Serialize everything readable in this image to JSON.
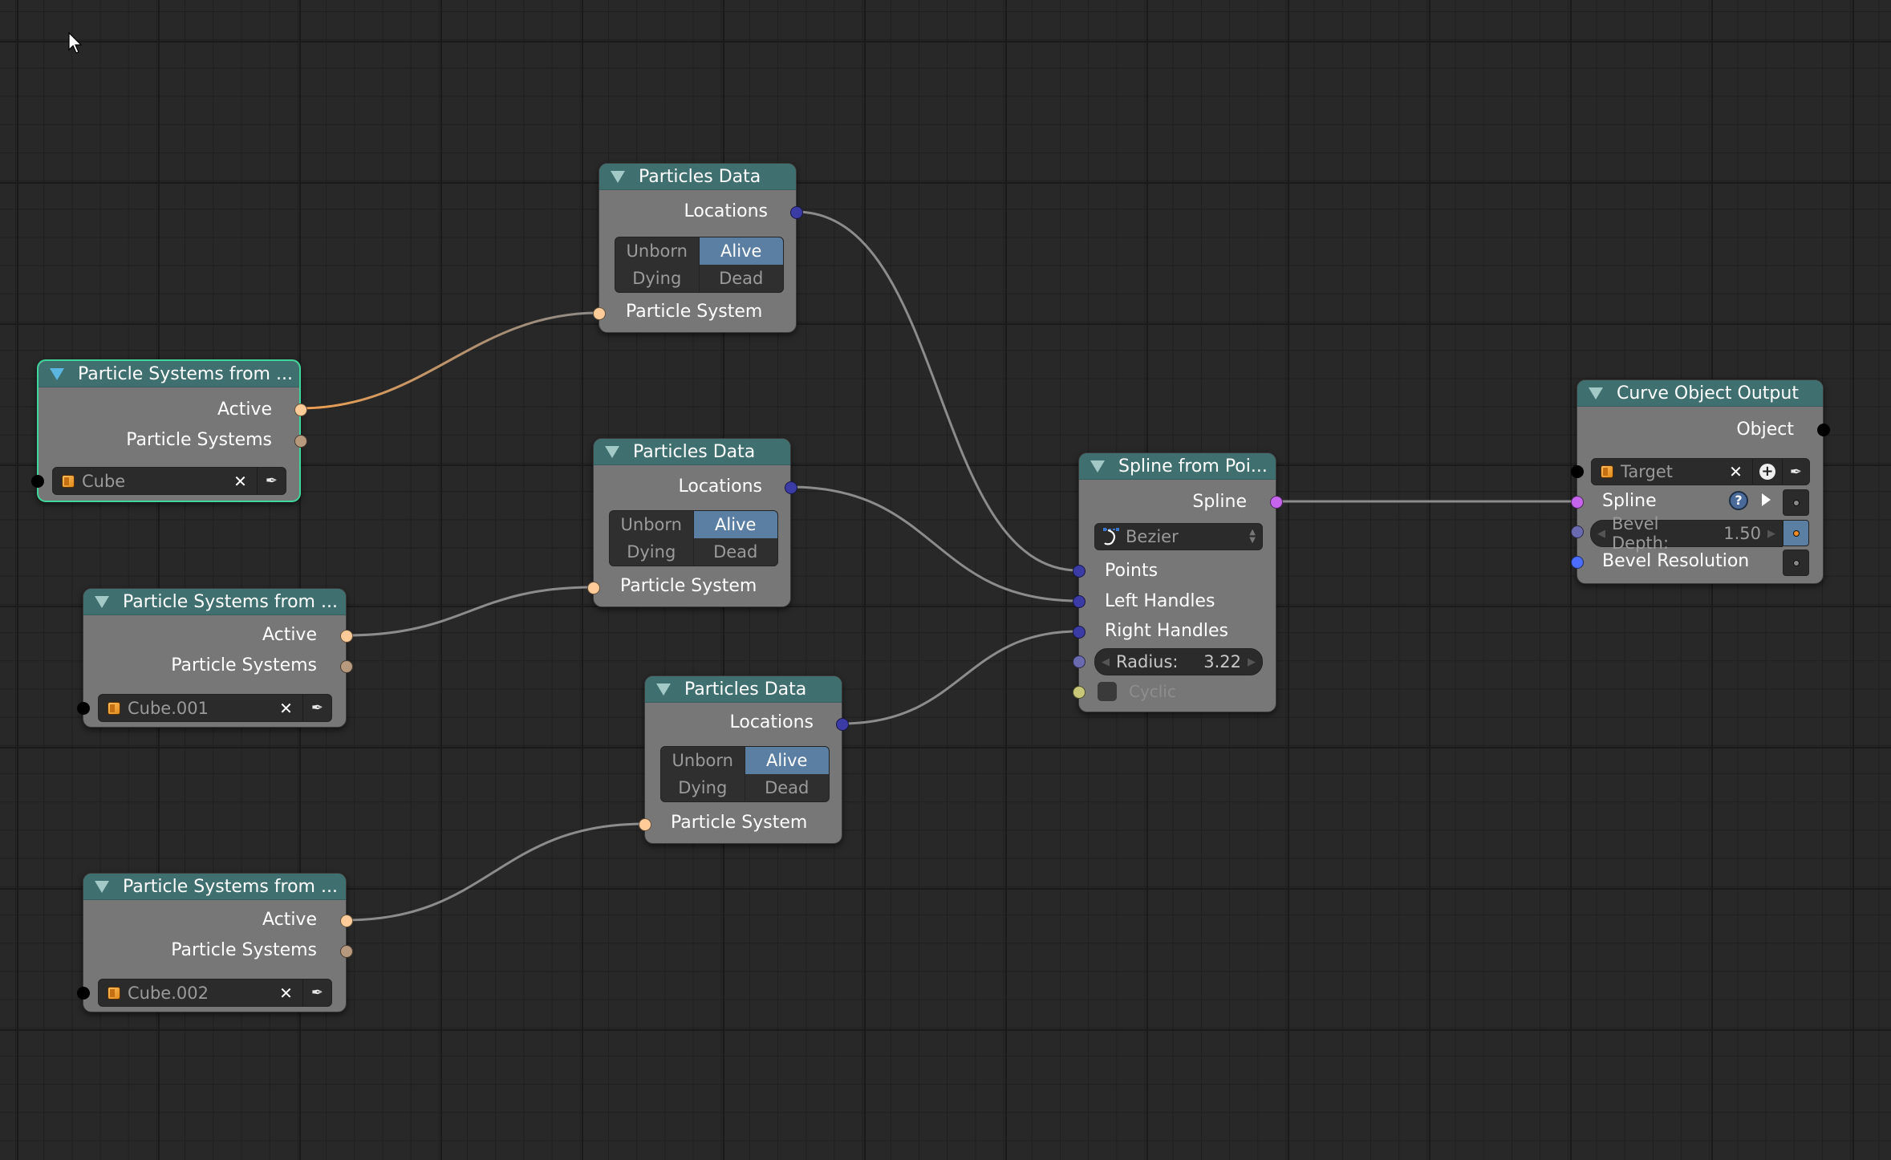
{
  "editor": "Animation Nodes node tree",
  "colors": {
    "background": "#282828",
    "node_body": "#777777",
    "node_header": "#3f6f6e",
    "selected_outline": "#3ed69a",
    "socket_particle_system": "#ffcc99",
    "socket_particle_system_list": "#b79a7d",
    "socket_vector_list": "#3b3ba6",
    "socket_float": "#6a6ab0",
    "socket_bool": "#c8c878",
    "socket_spline": "#c664ee",
    "socket_object": "#000000",
    "socket_integer": "#4a6cff",
    "toggle_active": "#5b7ea3"
  },
  "nodes": {
    "ps_from_object_1": {
      "title": "Particle Systems from ...",
      "selected": true,
      "outputs": [
        "Active",
        "Particle Systems"
      ],
      "object_field": {
        "value": "Cube",
        "icon": "cube-object-icon",
        "clear_icon": "x-icon",
        "picker_icon": "eyedropper-icon"
      }
    },
    "ps_from_object_2": {
      "title": "Particle Systems from ...",
      "selected": false,
      "outputs": [
        "Active",
        "Particle Systems"
      ],
      "object_field": {
        "value": "Cube.001",
        "icon": "cube-object-icon",
        "clear_icon": "x-icon",
        "picker_icon": "eyedropper-icon"
      }
    },
    "ps_from_object_3": {
      "title": "Particle Systems from ...",
      "selected": false,
      "outputs": [
        "Active",
        "Particle Systems"
      ],
      "object_field": {
        "value": "Cube.002",
        "icon": "cube-object-icon",
        "clear_icon": "x-icon",
        "picker_icon": "eyedropper-icon"
      }
    },
    "particles_data_1": {
      "title": "Particles Data",
      "output": "Locations",
      "states": [
        {
          "label": "Unborn",
          "active": false
        },
        {
          "label": "Alive",
          "active": true
        },
        {
          "label": "Dying",
          "active": false
        },
        {
          "label": "Dead",
          "active": false
        }
      ],
      "input": "Particle System"
    },
    "particles_data_2": {
      "title": "Particles Data",
      "output": "Locations",
      "states": [
        {
          "label": "Unborn",
          "active": false
        },
        {
          "label": "Alive",
          "active": true
        },
        {
          "label": "Dying",
          "active": false
        },
        {
          "label": "Dead",
          "active": false
        }
      ],
      "input": "Particle System"
    },
    "particles_data_3": {
      "title": "Particles Data",
      "output": "Locations",
      "states": [
        {
          "label": "Unborn",
          "active": false
        },
        {
          "label": "Alive",
          "active": true
        },
        {
          "label": "Dying",
          "active": false
        },
        {
          "label": "Dead",
          "active": false
        }
      ],
      "input": "Particle System"
    },
    "spline_from_points": {
      "title": "Spline from Poi...",
      "output": "Spline",
      "spline_type": {
        "value": "Bezier",
        "icon": "bezier-curve-icon"
      },
      "inputs": [
        "Points",
        "Left Handles",
        "Right Handles"
      ],
      "radius": {
        "label": "Radius:",
        "value": "3.22"
      },
      "cyclic": {
        "label": "Cyclic",
        "checked": false
      }
    },
    "curve_object_output": {
      "title": "Curve Object Output",
      "output": "Object",
      "target_field": {
        "placeholder": "Target",
        "icon": "cube-object-icon",
        "clear_icon": "x-icon",
        "new_icon": "plus-circle-icon",
        "picker_icon": "eyedropper-icon"
      },
      "spline_input": {
        "label": "Spline",
        "help_icon": "question-icon",
        "expand_icon": "play-triangle-icon"
      },
      "bevel_depth": {
        "label": "Bevel Depth:",
        "value": "1.50"
      },
      "bevel_resolution": {
        "label": "Bevel Resolution"
      }
    }
  },
  "links": [
    {
      "from": "ps_from_object_1.Active",
      "to": "particles_data_1.Particle System"
    },
    {
      "from": "ps_from_object_2.Active",
      "to": "particles_data_2.Particle System"
    },
    {
      "from": "ps_from_object_3.Active",
      "to": "particles_data_3.Particle System"
    },
    {
      "from": "particles_data_1.Locations",
      "to": "spline_from_points.Points"
    },
    {
      "from": "particles_data_2.Locations",
      "to": "spline_from_points.Left Handles"
    },
    {
      "from": "particles_data_3.Locations",
      "to": "spline_from_points.Right Handles"
    },
    {
      "from": "spline_from_points.Spline",
      "to": "curve_object_output.Spline"
    }
  ]
}
